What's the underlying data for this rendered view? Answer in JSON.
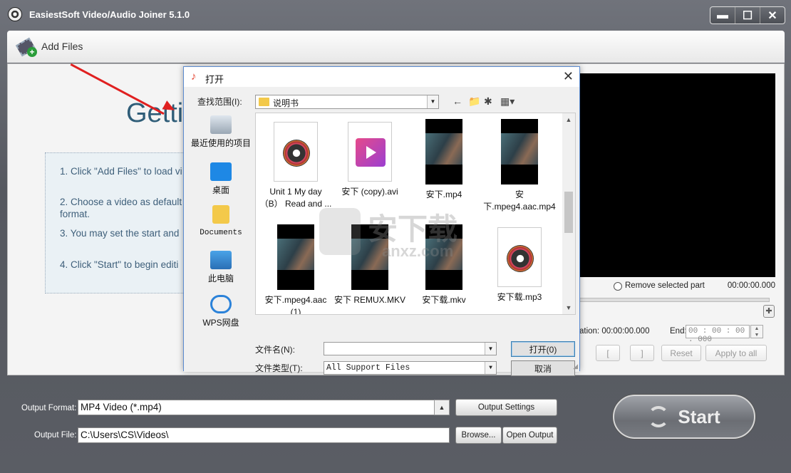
{
  "window": {
    "title": "EasiestSoft Video/Audio Joiner 5.1.0",
    "controls": [
      "▬",
      "☐",
      "✕"
    ]
  },
  "toolbar": {
    "add_files_label": "Add Files"
  },
  "main": {
    "heading": "Getti",
    "steps": [
      "1. Click \"Add Files\" to load vi",
      "2. Choose a video as default",
      "format.",
      "3. You may set the start and",
      "4. Click \"Start\" to begin editi"
    ]
  },
  "player": {
    "remove_label": "Remove selected part",
    "total_time": "00:00:00.000",
    "duration_text": "ation: 00:00:00.000",
    "end_label": "End:",
    "end_value": "00 : 00 : 00 . 000",
    "btn_start_mark": "[",
    "btn_end_mark": "]",
    "reset_label": "Reset",
    "apply_all_label": "Apply to all"
  },
  "output": {
    "format_label": "Output Format:",
    "format_value": "MP4 Video (*.mp4)",
    "settings_label": "Output Settings",
    "file_label": "Output File:",
    "file_value": "C:\\Users\\CS\\Videos\\",
    "browse_label": "Browse...",
    "open_output_label": "Open Output",
    "start_label": "Start"
  },
  "dialog": {
    "title": "打开",
    "lookin_label": "查找范围(I):",
    "lookin_value": "说明书",
    "places": [
      "最近使用的项目",
      "桌面",
      "Documents",
      "此电脑",
      "WPS网盘"
    ],
    "files": [
      {
        "name": "Unit 1 My day （B） Read and ...",
        "type": "audio"
      },
      {
        "name": "安下 (copy).avi",
        "type": "video-file"
      },
      {
        "name": "安下.mp4",
        "type": "movie"
      },
      {
        "name": "安下.mpeg4.aac.mp4",
        "type": "movie"
      },
      {
        "name": "安下.mpeg4.aac (1)",
        "type": "movie"
      },
      {
        "name": "安下 REMUX.MKV",
        "type": "movie"
      },
      {
        "name": "安下载.mkv",
        "type": "movie"
      },
      {
        "name": "安下载.mp3",
        "type": "audio"
      }
    ],
    "filename_label": "文件名(N):",
    "filename_value": "",
    "filetype_label": "文件类型(T):",
    "filetype_value": "All Support Files",
    "open_label": "打开(0)",
    "cancel_label": "取消"
  },
  "watermark": {
    "text": "安下载",
    "sub": "anxz.com"
  },
  "colors": {
    "heading": "#2f5d78",
    "step_text": "#3e5f7a",
    "arrow": "#e02020",
    "dialog_border": "#5b8bd0"
  }
}
